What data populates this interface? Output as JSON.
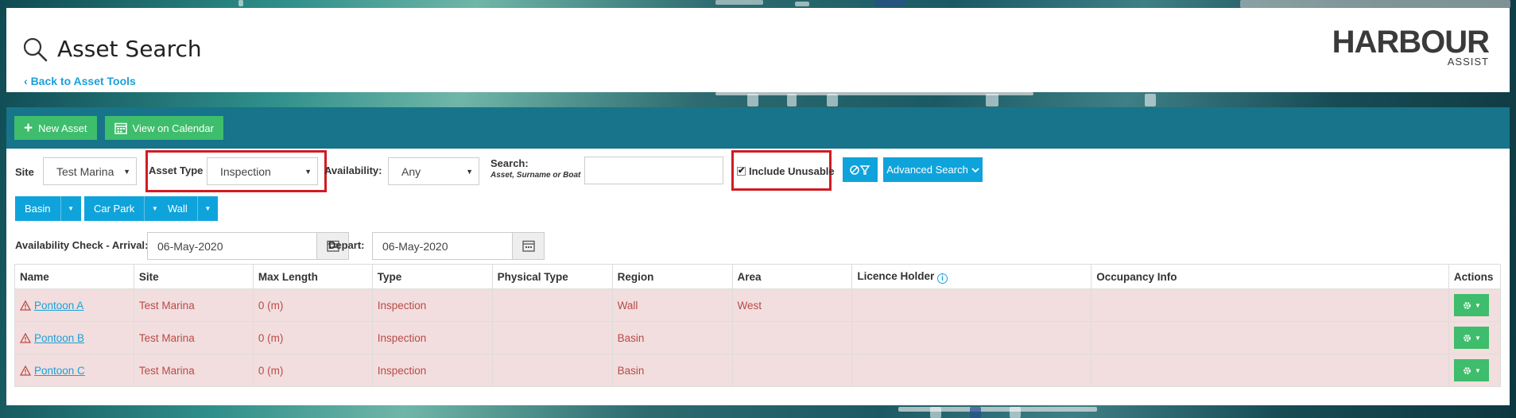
{
  "header": {
    "title": "Asset Search",
    "back_link": "Back to Asset Tools",
    "logo_main": "HARBOUR",
    "logo_sub": "ASSIST"
  },
  "toolbar": {
    "new_asset": "New Asset",
    "view_calendar": "View on Calendar"
  },
  "filters": {
    "site_label": "Site",
    "site_value": "Test Marina",
    "asset_type_label": "Asset Type",
    "asset_type_value": "Inspection",
    "availability_label": "Availability:",
    "availability_value": "Any",
    "search_label": "Search:",
    "search_hint": "Asset, Surname or Boat",
    "search_value": "",
    "include_unusable_label": "Include Unusable",
    "include_unusable_checked": true,
    "advanced_search": "Advanced Search",
    "area_buttons": [
      "Basin",
      "Car Park",
      "Wall"
    ],
    "arrival_label": "Availability Check - Arrival:",
    "arrival_value": "06-May-2020",
    "depart_label": "Depart:",
    "depart_value": "06-May-2020"
  },
  "table": {
    "columns": [
      "Name",
      "Site",
      "Max Length",
      "Type",
      "Physical Type",
      "Region",
      "Area",
      "Licence Holder",
      "Occupancy Info",
      "Actions"
    ],
    "rows": [
      {
        "name": "Pontoon A",
        "site": "Test Marina",
        "max_length": "0 (m)",
        "type": "Inspection",
        "physical_type": "",
        "region": "Wall",
        "area": "West",
        "licence_holder": "",
        "occupancy_info": ""
      },
      {
        "name": "Pontoon B",
        "site": "Test Marina",
        "max_length": "0 (m)",
        "type": "Inspection",
        "physical_type": "",
        "region": "Basin",
        "area": "",
        "licence_holder": "",
        "occupancy_info": ""
      },
      {
        "name": "Pontoon C",
        "site": "Test Marina",
        "max_length": "0 (m)",
        "type": "Inspection",
        "physical_type": "",
        "region": "Basin",
        "area": "",
        "licence_holder": "",
        "occupancy_info": ""
      }
    ]
  },
  "colors": {
    "toolbar_bg": "#17748a",
    "green": "#3ebd6c",
    "blue": "#0fa3dc",
    "unusable_row_bg": "#f2dede",
    "unusable_row_text": "#b94a48",
    "highlight_red": "#d11b22"
  },
  "icons": {
    "title": "search-icon",
    "new_asset": "plus-icon",
    "calendar": "calendar-icon",
    "clear_filter": "clear-filter-icon",
    "warning": "warning-icon",
    "actions": "gear-icon",
    "info": "info-icon"
  }
}
